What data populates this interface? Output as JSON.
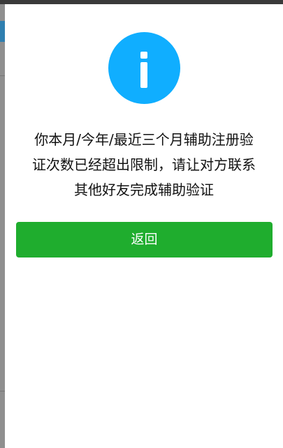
{
  "dialog": {
    "icon": "info-icon",
    "message_lines": [
      "你本月/今年/最近三个月辅助注册验",
      "证次数已经超出限制，请让对方联系",
      "其他好友完成辅助验证"
    ],
    "button_label": "返回"
  },
  "colors": {
    "icon_circle": "#10aeff",
    "button": "#1fad2e",
    "button_text": "#ffffff",
    "message_text": "#111111"
  }
}
